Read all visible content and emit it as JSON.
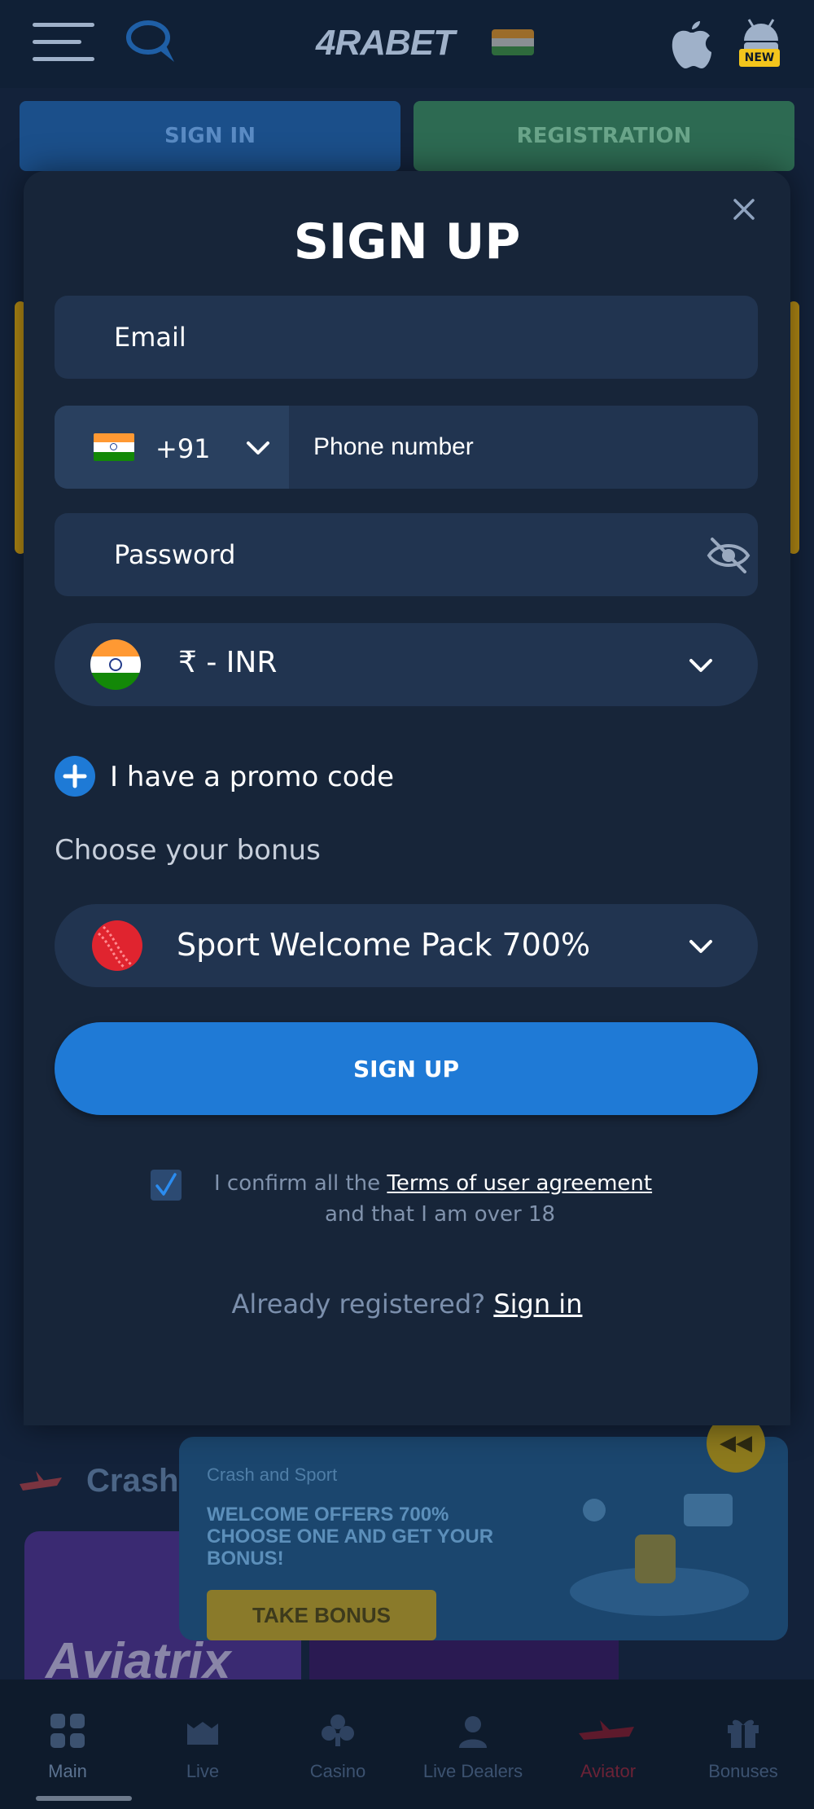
{
  "header": {
    "logo_text": "4RABET",
    "new_badge": "NEW"
  },
  "auth_tabs": {
    "sign_in": "SIGN IN",
    "registration": "REGISTRATION"
  },
  "modal": {
    "title": "SIGN UP",
    "email_placeholder": "Email",
    "phone_code": "+91",
    "phone_placeholder": "Phone number",
    "password_placeholder": "Password",
    "currency": "₹ - INR",
    "promo_toggle_label": "I have a promo code",
    "bonus_heading": "Choose your bonus",
    "bonus_selected": "Sport Welcome Pack 700%",
    "signup_button": "SIGN UP",
    "terms_prefix": "I confirm all the ",
    "terms_link": "Terms of user agreement",
    "terms_suffix": "and that I am over 18",
    "already_registered": "Already registered? ",
    "sign_in_link": "Sign in"
  },
  "background": {
    "section_title": "Crash",
    "game_title": "Aviatrix",
    "promo": {
      "subtitle": "Crash and Sport",
      "headline": "WELCOME OFFERS 700% CHOOSE ONE AND GET YOUR BONUS!",
      "button": "TAKE BONUS"
    }
  },
  "bottom_nav": {
    "items": [
      {
        "label": "Main"
      },
      {
        "label": "Live"
      },
      {
        "label": "Casino"
      },
      {
        "label": "Live Dealers"
      },
      {
        "label": "Aviator"
      },
      {
        "label": "Bonuses"
      }
    ]
  },
  "colors": {
    "accent_blue": "#1f7ad6",
    "modal_bg": "#172539",
    "field_bg": "#213450"
  }
}
